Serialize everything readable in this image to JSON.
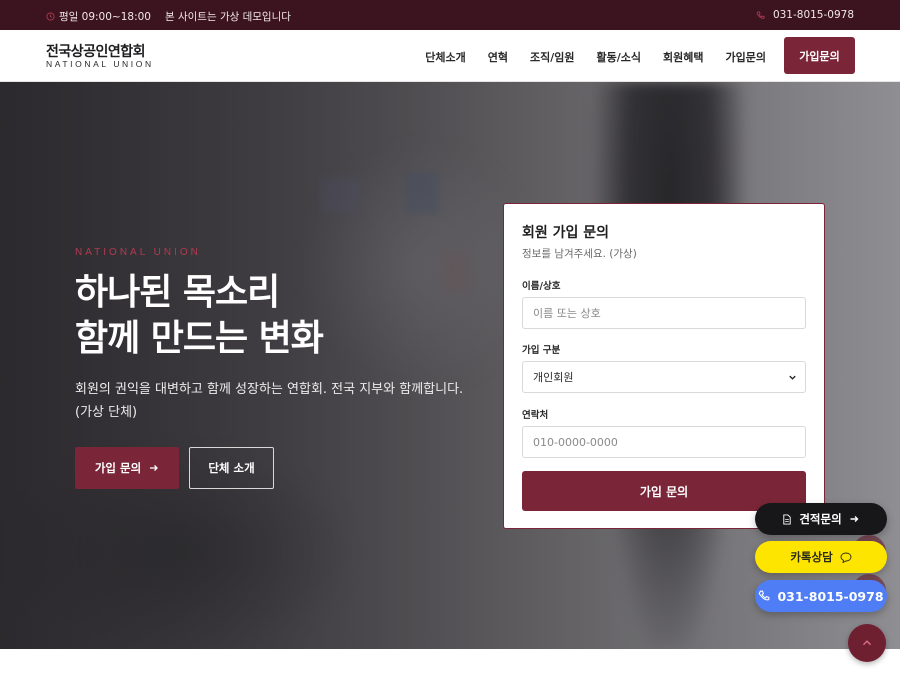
{
  "topbar": {
    "hours": "평일 09:00~18:00",
    "notice": "본 사이트는 가상 데모입니다",
    "phone": "031-8015-0978"
  },
  "header": {
    "logo_main": "전국상공인연합회",
    "logo_sub": "NATIONAL UNION",
    "nav": [
      "단체소개",
      "연혁",
      "조직/임원",
      "활동/소식",
      "회원혜택",
      "가입문의"
    ],
    "cta": "가입문의"
  },
  "hero": {
    "eyebrow": "NATIONAL UNION",
    "headline_line1": "하나된 목소리",
    "headline_line2": "함께 만드는 변화",
    "subtext": "회원의 권익을 대변하고 함께 성장하는 연합회. 전국 지부와 함께합니다. (가상 단체)",
    "btn_primary": "가입 문의",
    "btn_secondary": "단체 소개"
  },
  "form": {
    "title": "회원 가입 문의",
    "desc": "정보를 남겨주세요. (가상)",
    "name_label": "이름/상호",
    "name_placeholder": "이름 또는 상호",
    "type_label": "가입 구분",
    "type_value": "개인회원",
    "contact_label": "연락처",
    "contact_placeholder": "010-0000-0000",
    "submit": "가입 문의"
  },
  "floating": {
    "quote": "견적문의",
    "kakao": "카톡상담",
    "call": "031-8015-0978"
  },
  "colors": {
    "brand": "#7a2638",
    "topbar": "#3b1420",
    "kakao": "#fee500",
    "call": "#4f7df5"
  }
}
